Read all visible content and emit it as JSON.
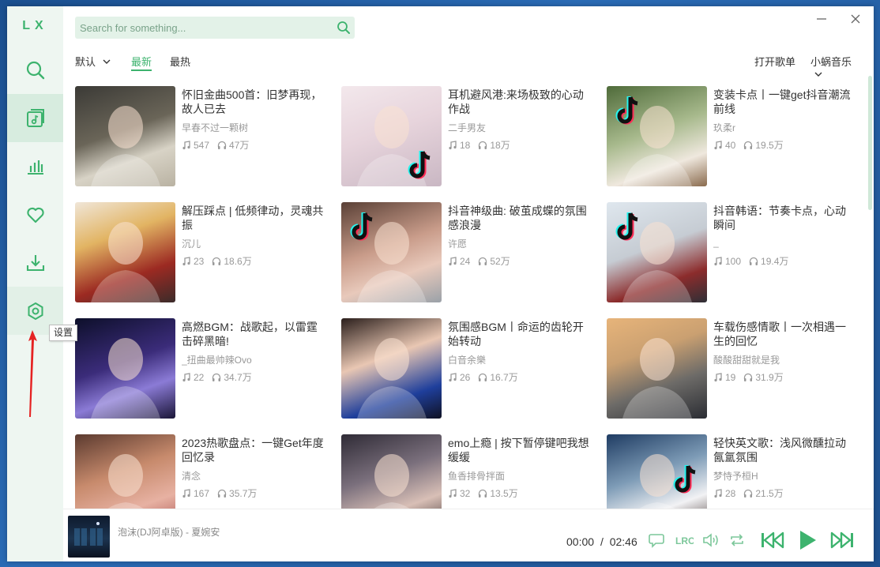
{
  "app": {
    "logo": "LX"
  },
  "sidebar": {
    "items": [
      {
        "name": "search",
        "icon": "search-icon"
      },
      {
        "name": "song-list",
        "icon": "music-list-icon",
        "active": true
      },
      {
        "name": "leaderboard",
        "icon": "bar-chart-icon"
      },
      {
        "name": "favorites",
        "icon": "heart-icon"
      },
      {
        "name": "download",
        "icon": "download-icon"
      },
      {
        "name": "settings",
        "icon": "settings-icon"
      }
    ],
    "tooltip": "设置"
  },
  "search": {
    "placeholder": "Search for something..."
  },
  "subnav": {
    "sort_label": "默认",
    "tab_newest": "最新",
    "tab_hottest": "最热",
    "open_playlist": "打开歌单",
    "source": "小蜗音乐"
  },
  "playlists": [
    {
      "title": "怀旧金曲500首：旧梦再现，故人已去",
      "author": "早春不过一颗树",
      "songs": "547",
      "plays": "47万"
    },
    {
      "title": "耳机避风港:来场极致的心动作战",
      "author": "二手男友",
      "songs": "18",
      "plays": "18万"
    },
    {
      "title": "变装卡点丨一键get抖音潮流前线",
      "author": "玖柔r",
      "songs": "40",
      "plays": "19.5万"
    },
    {
      "title": "解压踩点 | 低频律动，灵魂共振",
      "author": "沉儿",
      "songs": "23",
      "plays": "18.6万"
    },
    {
      "title": "抖音神级曲: 破茧成蝶的氛围感浪漫",
      "author": "许愿",
      "songs": "24",
      "plays": "52万"
    },
    {
      "title": "抖音韩语：节奏卡点，心动瞬间",
      "author": "_",
      "songs": "100",
      "plays": "19.4万"
    },
    {
      "title": "高燃BGM：战歌起，以雷霆击碎黑暗!",
      "author": "_扭曲最帅辣Ovo",
      "songs": "22",
      "plays": "34.7万"
    },
    {
      "title": "氛围感BGM丨命运的齿轮开始转动",
      "author": "白音余樂",
      "songs": "26",
      "plays": "16.7万"
    },
    {
      "title": "车载伤感情歌丨一次相遇一生的回忆",
      "author": "酸酸甜甜就是我",
      "songs": "19",
      "plays": "31.9万"
    },
    {
      "title": "2023热歌盘点：一键Get年度回忆录",
      "author": "清念",
      "songs": "167",
      "plays": "35.7万"
    },
    {
      "title": "emo上瘾 | 按下暂停键吧我想缓缓",
      "author": "鱼香排骨拌面",
      "songs": "32",
      "plays": "13.5万"
    },
    {
      "title": "轻快英文歌：浅风微醺拉动氤氲氛围",
      "author": "梦恃予桓H",
      "songs": "28",
      "plays": "21.5万"
    }
  ],
  "player": {
    "track": "泡沫(DJ阿卓版) - 夏婉安",
    "current_time": "00:00",
    "separator": "/",
    "duration": "02:46"
  },
  "colors": {
    "accent": "#3db36e",
    "sidebar_bg": "#eef6f1",
    "search_bg": "#e3f2e8"
  }
}
